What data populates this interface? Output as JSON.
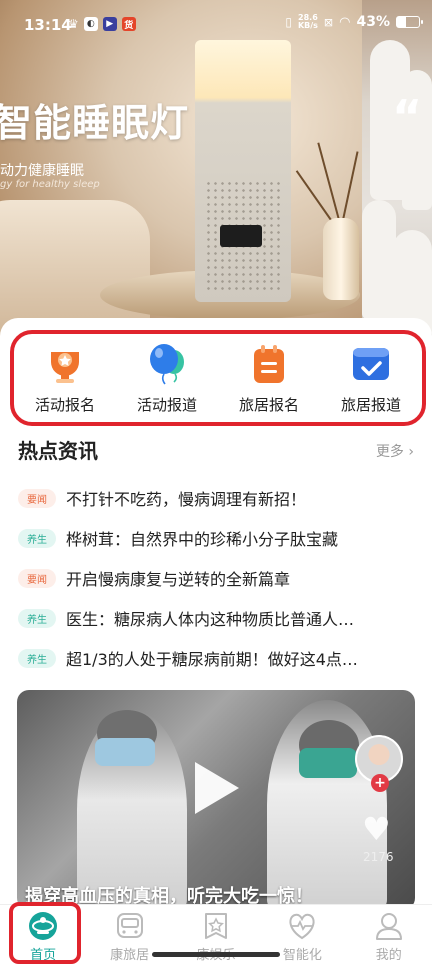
{
  "status_bar": {
    "time": "13:14",
    "net_speed_value": "28.6",
    "net_speed_unit": "KB/s",
    "battery": "43%",
    "battery_level": 0.43
  },
  "banner": {
    "title": "智能睡眠灯",
    "subtitle": "动力健康睡眠",
    "subtitle_en": "gy for healthy sleep"
  },
  "quick_actions": [
    {
      "label": "活动报名",
      "icon": "trophy-icon",
      "color": "#f0742c"
    },
    {
      "label": "活动报道",
      "icon": "balloon-icon",
      "color": "#2e7de9"
    },
    {
      "label": "旅居报名",
      "icon": "clipboard-icon",
      "color": "#f0742c"
    },
    {
      "label": "旅居报道",
      "icon": "check-box-icon",
      "color": "#2e6fe0"
    }
  ],
  "news": {
    "title": "热点资讯",
    "more": "更多",
    "items": [
      {
        "tag": "要闻",
        "tag_color": "red",
        "text": "不打针不吃药，慢病调理有新招！"
      },
      {
        "tag": "养生",
        "tag_color": "green",
        "text": "桦树茸：自然界中的珍稀小分子肽宝藏"
      },
      {
        "tag": "要闻",
        "tag_color": "red",
        "text": "开启慢病康复与逆转的全新篇章"
      },
      {
        "tag": "养生",
        "tag_color": "green",
        "text": "医生：糖尿病人体内这种物质比普通人…"
      },
      {
        "tag": "养生",
        "tag_color": "green",
        "text": "超1/3的人处于糖尿病前期！做好这4点…"
      }
    ]
  },
  "video": {
    "likes": "2176",
    "caption": "揭穿高血压的真相，听完大吃一惊！"
  },
  "tabs": [
    {
      "label": "首页",
      "icon": "home-icon",
      "active": true
    },
    {
      "label": "康旅居",
      "icon": "bus-icon",
      "active": false
    },
    {
      "label": "康娱乐",
      "icon": "star-badge-icon",
      "active": false
    },
    {
      "label": "智能化",
      "icon": "heart-pulse-icon",
      "active": false
    },
    {
      "label": "我的",
      "icon": "profile-icon",
      "active": false
    }
  ],
  "colors": {
    "accent": "#16a49a",
    "highlight": "#e0242d"
  }
}
